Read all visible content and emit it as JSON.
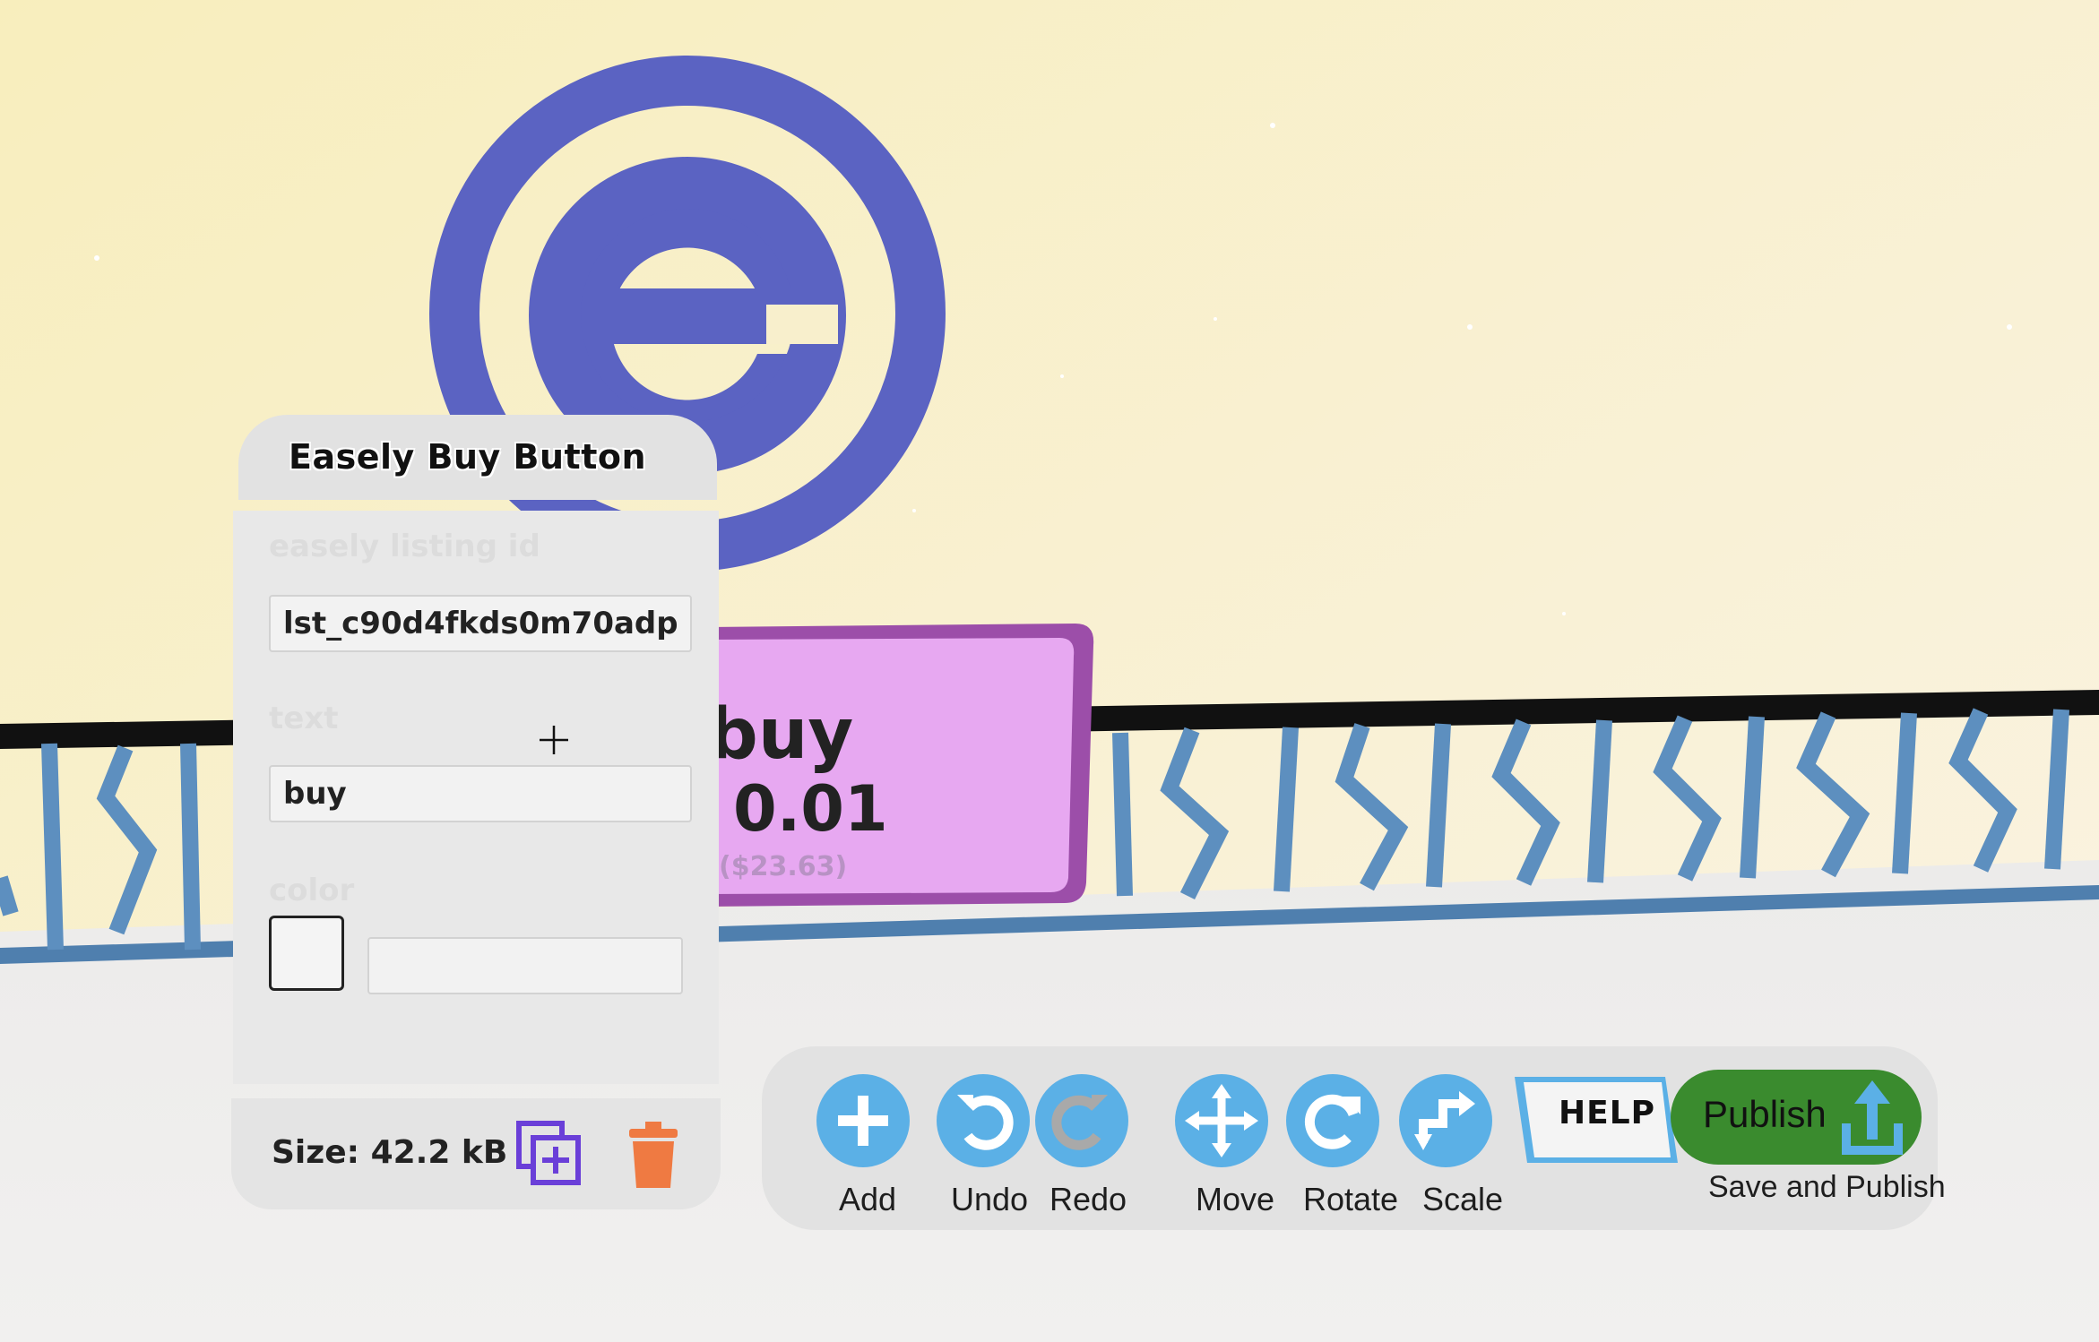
{
  "panel": {
    "title": "Easely Buy Button",
    "fields": [
      {
        "label": "easely listing id",
        "value": "lst_c90d4fkds0m70adp"
      },
      {
        "label": "text",
        "value": "buy"
      },
      {
        "label": "color",
        "value": ""
      }
    ],
    "size_text": "Size: 42.2 kB"
  },
  "sign": {
    "word": "buy",
    "price": "0.01",
    "usd": "($23.63)"
  },
  "toolbar": {
    "add": "Add",
    "undo": "Undo",
    "redo": "Redo",
    "move": "Move",
    "rotate": "Rotate",
    "scale": "Scale",
    "help": "HELP",
    "publish": "Publish",
    "save_and_publish": "Save and Publish"
  },
  "colors": {
    "logo": "#5b63c2",
    "sign_fill": "#e7a8f1",
    "sign_border": "#9c4ea9",
    "tool_blue": "#5bb0e6",
    "tool_disabled": "#a9c9e3",
    "publish_green": "#3a8b2e",
    "trash_orange": "#ef7a42",
    "duplicate_purple": "#6a3fd8"
  }
}
